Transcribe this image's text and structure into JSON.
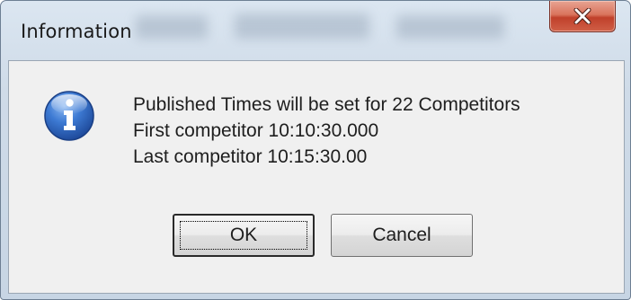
{
  "window": {
    "title": "Information",
    "close_glyph": "X"
  },
  "message": {
    "line1": "Published Times will be set for 22 Competitors",
    "line2": "First competitor  10:10:30.000",
    "line3": "Last competitor  10:15:30.00"
  },
  "buttons": {
    "ok_label": "OK",
    "cancel_label": "Cancel"
  },
  "icons": {
    "info": "information-icon",
    "close": "close-icon"
  },
  "colors": {
    "info_icon_blue": "#2f6bc4",
    "close_button_red": "#c7432c",
    "dialog_body": "#f0f0f0"
  }
}
